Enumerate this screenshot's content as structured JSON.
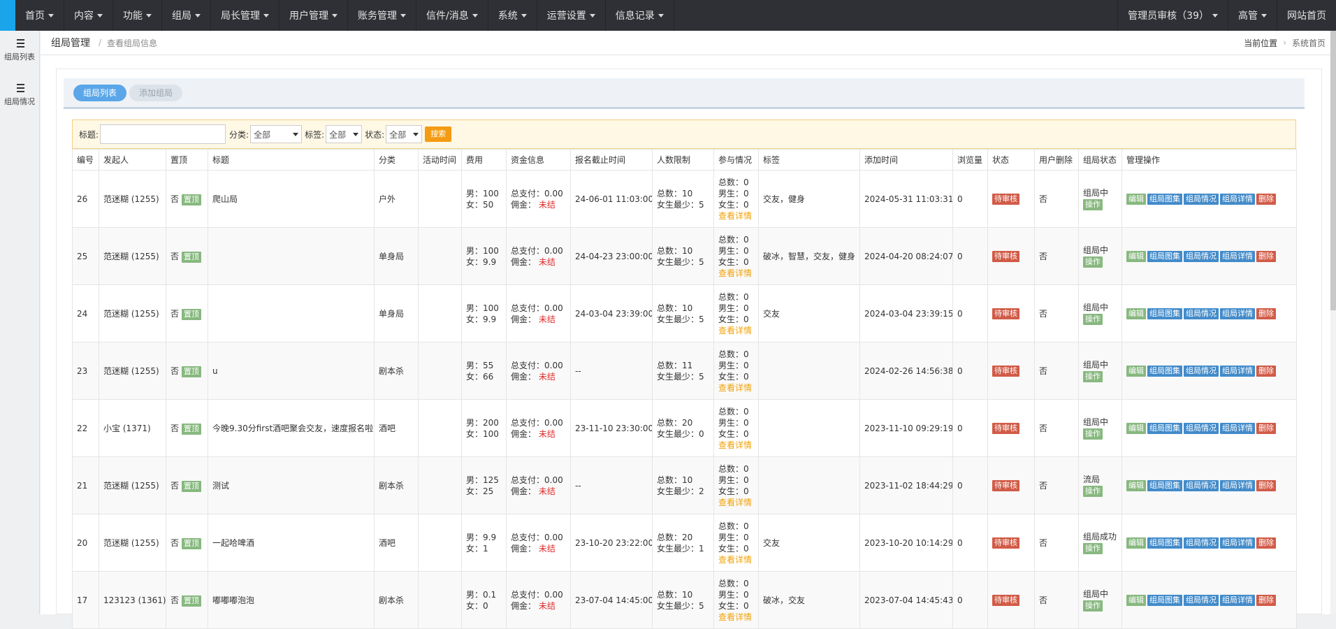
{
  "topnav": {
    "items": [
      "首页",
      "内容",
      "功能",
      "组局",
      "局长管理",
      "用户管理",
      "账务管理",
      "信件/消息",
      "系统",
      "运营设置",
      "信息记录"
    ],
    "right": [
      "管理员审核（39）",
      "高管",
      "网站首页"
    ]
  },
  "leftnav": {
    "items": [
      "组局列表",
      "组局情况"
    ]
  },
  "breadcrumb": {
    "main": "组局管理",
    "sub": "查看组局信息",
    "location_label": "当前位置",
    "home": "系统首页"
  },
  "tabs": {
    "list": "组局列表",
    "add": "添加组局"
  },
  "filter": {
    "title_label": "标题:",
    "category_label": "分类:",
    "category_value": "全部",
    "tag_label": "标签:",
    "tag_value": "全部",
    "status_label": "状态:",
    "status_value": "全部",
    "search_btn": "搜索"
  },
  "columns": [
    "编号",
    "发起人",
    "置顶",
    "标题",
    "分类",
    "活动时间",
    "费用",
    "资金信息",
    "报名截止时间",
    "人数限制",
    "参与情况",
    "标签",
    "添加时间",
    "浏览量",
    "状态",
    "用户删除",
    "组局状态",
    "管理操作"
  ],
  "labels": {
    "no": "否",
    "pin_btn": "置顶",
    "pay_prefix": "总支付：",
    "comm_prefix": "佣金：",
    "comm_status": "未结",
    "total_prefix": "总数：",
    "male_prefix": "男生：",
    "female_prefix": "女生：",
    "min_female_prefix": "女生最少：",
    "fee_male": "男：",
    "fee_female": "女：",
    "detail_link": "查看详情",
    "status_badge": "待审核",
    "op_btn": "操作",
    "actions": [
      "编辑",
      "组局图集",
      "组局情况",
      "组局详情",
      "删除"
    ]
  },
  "rows": [
    {
      "id": "26",
      "creator": "范迷糊 (1255)",
      "title": "爬山局",
      "category": "户外",
      "fee_m": "100",
      "fee_f": "50",
      "pay": "0.00",
      "deadline": "24-06-01 11:03:00",
      "limit_total": "10",
      "limit_female": "5",
      "part_total": "0",
      "part_male": "0",
      "part_female": "0",
      "tags": "交友，健身",
      "added": "2024-05-31 11:03:31",
      "views": "0",
      "deleted": "否",
      "party_status": "组局中"
    },
    {
      "id": "25",
      "creator": "范迷糊 (1255)",
      "title": "",
      "category": "单身局",
      "fee_m": "100",
      "fee_f": "9.9",
      "pay": "0.00",
      "deadline": "24-04-23 23:00:00",
      "limit_total": "10",
      "limit_female": "5",
      "part_total": "0",
      "part_male": "0",
      "part_female": "0",
      "tags": "破冰，智慧，交友，健身",
      "added": "2024-04-20 08:24:07",
      "views": "0",
      "deleted": "否",
      "party_status": "组局中"
    },
    {
      "id": "24",
      "creator": "范迷糊 (1255)",
      "title": "",
      "category": "单身局",
      "fee_m": "100",
      "fee_f": "9.9",
      "pay": "0.00",
      "deadline": "24-03-04 23:39:00",
      "limit_total": "10",
      "limit_female": "5",
      "part_total": "0",
      "part_male": "0",
      "part_female": "0",
      "tags": "交友",
      "added": "2024-03-04 23:39:15",
      "views": "0",
      "deleted": "否",
      "party_status": "组局中"
    },
    {
      "id": "23",
      "creator": "范迷糊 (1255)",
      "title": "u",
      "category": "剧本杀",
      "fee_m": "55",
      "fee_f": "66",
      "pay": "0.00",
      "deadline": "--",
      "limit_total": "11",
      "limit_female": "5",
      "part_total": "0",
      "part_male": "0",
      "part_female": "0",
      "tags": "",
      "added": "2024-02-26 14:56:38",
      "views": "0",
      "deleted": "否",
      "party_status": "组局中"
    },
    {
      "id": "22",
      "creator": "小宝 (1371)",
      "title": "今晚9.30分first酒吧聚会交友，速度报名啦",
      "category": "酒吧",
      "fee_m": "200",
      "fee_f": "100",
      "pay": "0.00",
      "deadline": "23-11-10 23:30:00",
      "limit_total": "20",
      "limit_female": "0",
      "part_total": "0",
      "part_male": "0",
      "part_female": "0",
      "tags": "",
      "added": "2023-11-10 09:29:19",
      "views": "0",
      "deleted": "否",
      "party_status": "组局中"
    },
    {
      "id": "21",
      "creator": "范迷糊 (1255)",
      "title": "测试",
      "category": "剧本杀",
      "fee_m": "125",
      "fee_f": "25",
      "pay": "0.00",
      "deadline": "--",
      "limit_total": "10",
      "limit_female": "2",
      "part_total": "0",
      "part_male": "0",
      "part_female": "0",
      "tags": "",
      "added": "2023-11-02 18:44:29",
      "views": "0",
      "deleted": "否",
      "party_status": "流局"
    },
    {
      "id": "20",
      "creator": "范迷糊 (1255)",
      "title": "一起哈啤酒",
      "category": "酒吧",
      "fee_m": "9.9",
      "fee_f": "1",
      "pay": "0.00",
      "deadline": "23-10-20 23:22:00",
      "limit_total": "20",
      "limit_female": "1",
      "part_total": "0",
      "part_male": "0",
      "part_female": "0",
      "tags": "交友",
      "added": "2023-10-20 10:14:29",
      "views": "0",
      "deleted": "否",
      "party_status": "组局成功"
    },
    {
      "id": "17",
      "creator": "123123 (1361)",
      "title": "嘟嘟嘟泡泡",
      "category": "剧本杀",
      "fee_m": "0.1",
      "fee_f": "0",
      "pay": "0.00",
      "deadline": "23-07-04 14:45:00",
      "limit_total": "10",
      "limit_female": "5",
      "part_total": "0",
      "part_male": "0",
      "part_female": "0",
      "tags": "破冰，交友",
      "added": "2023-07-04 14:45:43",
      "views": "0",
      "deleted": "否",
      "party_status": "组局中"
    }
  ]
}
